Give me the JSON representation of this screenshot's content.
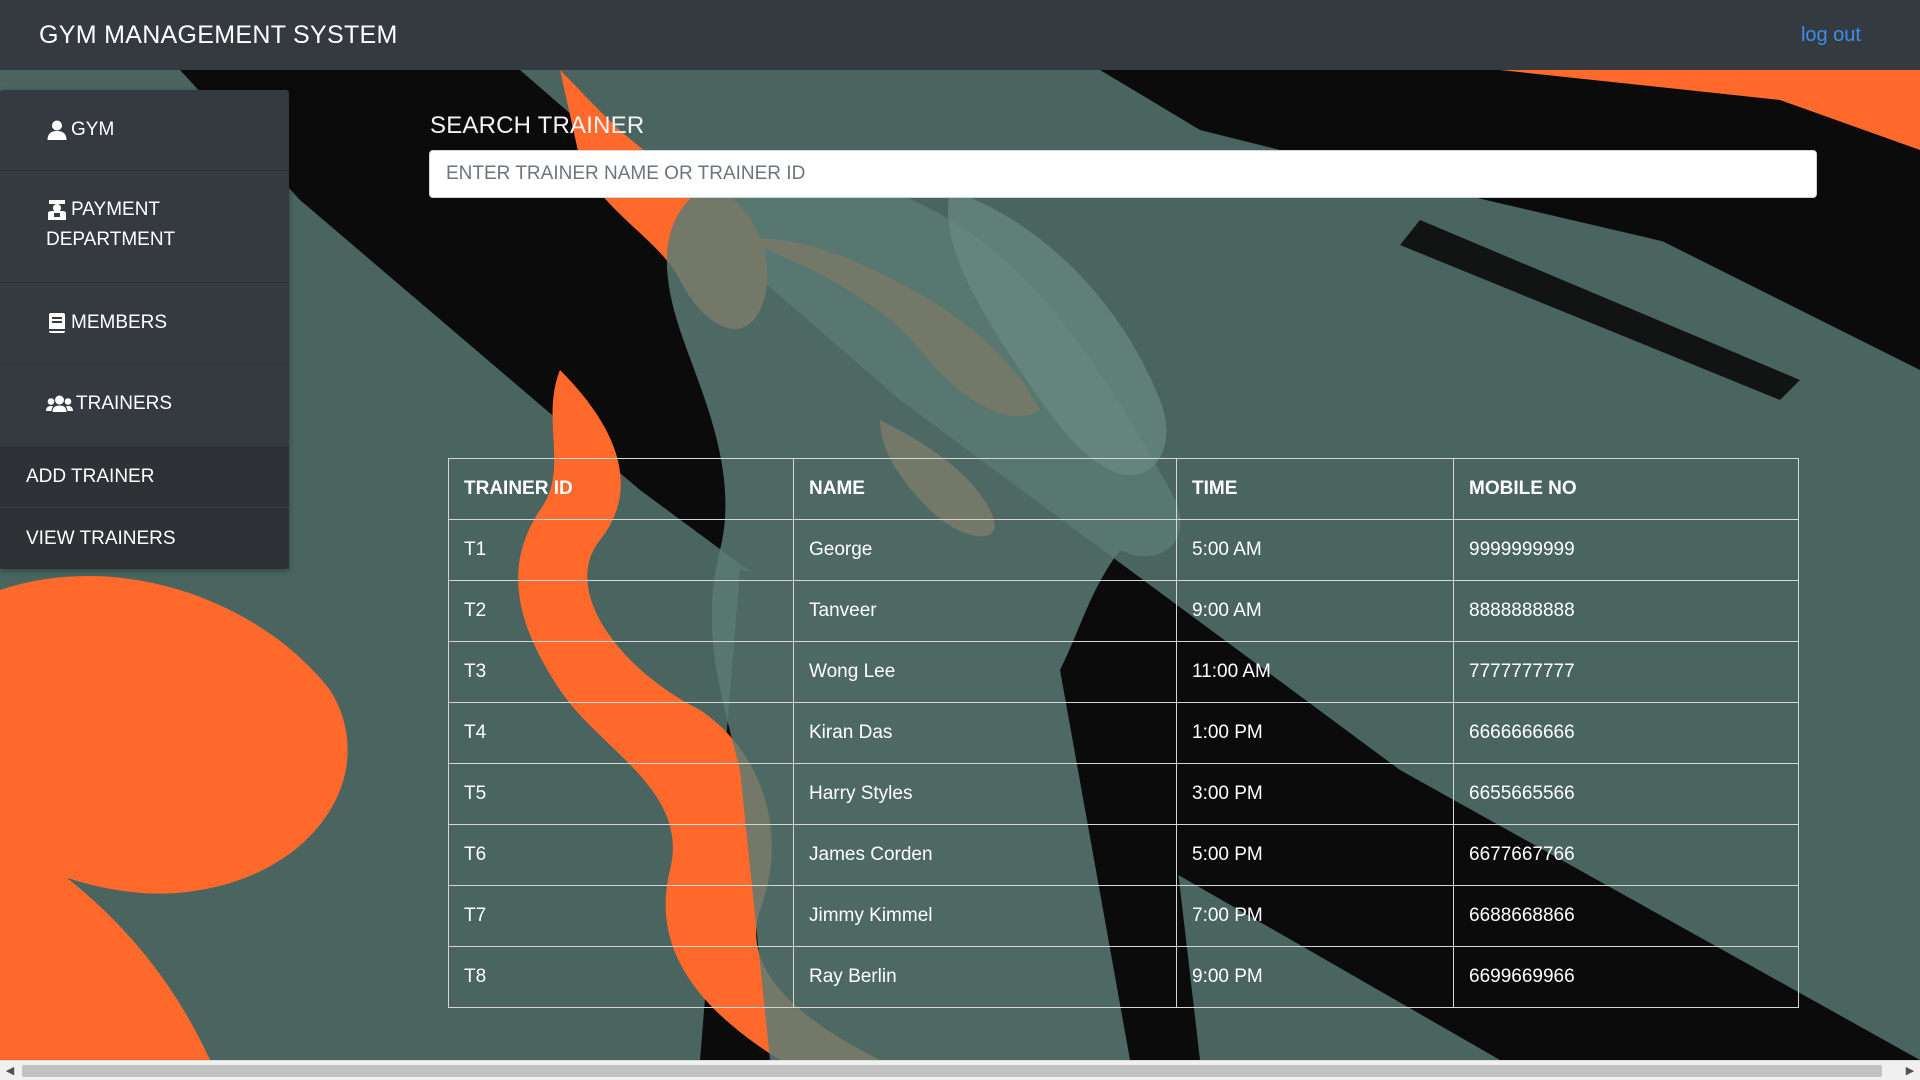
{
  "header": {
    "title": "GYM MANAGEMENT SYSTEM",
    "logout_label": "log out"
  },
  "sidebar": {
    "items": [
      {
        "icon": "user-icon",
        "label": "GYM"
      },
      {
        "icon": "cashier-icon",
        "label_line1": "PAYMENT",
        "label_line2": "DEPARTMENT"
      },
      {
        "icon": "book-icon",
        "label": "MEMBERS"
      },
      {
        "icon": "users-icon",
        "label": "TRAINERS"
      }
    ],
    "submenu": [
      {
        "label": "ADD TRAINER"
      },
      {
        "label": "VIEW TRAINERS"
      }
    ]
  },
  "search": {
    "label": "SEARCH TRAINER",
    "placeholder": "ENTER TRAINER NAME OR TRAINER ID",
    "value": ""
  },
  "table": {
    "headers": [
      "TRAINER ID",
      "NAME",
      "TIME",
      "MOBILE NO"
    ],
    "rows": [
      [
        "T1",
        "George",
        "5:00 AM",
        "9999999999"
      ],
      [
        "T2",
        "Tanveer",
        "9:00 AM",
        "8888888888"
      ],
      [
        "T3",
        "Wong Lee",
        "11:00 AM",
        "7777777777"
      ],
      [
        "T4",
        "Kiran Das",
        "1:00 PM",
        "6666666666"
      ],
      [
        "T5",
        "Harry Styles",
        "3:00 PM",
        "6655665566"
      ],
      [
        "T6",
        "James Corden",
        "5:00 PM",
        "6677667766"
      ],
      [
        "T7",
        "Jimmy Kimmel",
        "7:00 PM",
        "6688668866"
      ],
      [
        "T8",
        "Ray Berlin",
        "9:00 PM",
        "6699669966"
      ]
    ]
  },
  "colors": {
    "navbar": "#343a40",
    "link": "#3c8ee8",
    "background_teal": "#4a6560",
    "accent_orange": "#ff6a2c",
    "dark": "#0a0a0a"
  }
}
